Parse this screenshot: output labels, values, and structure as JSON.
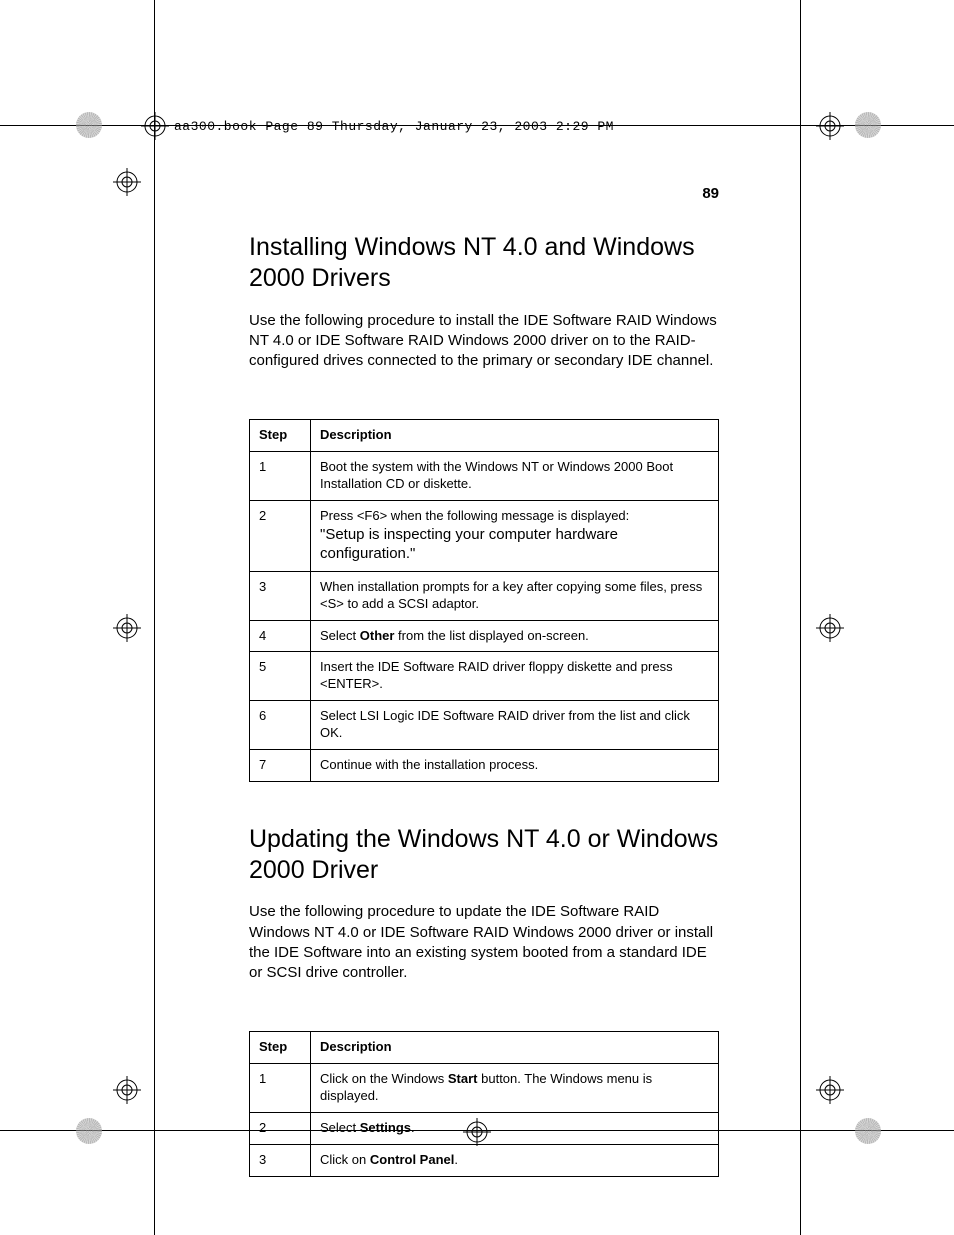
{
  "meta_header": "aa300.book  Page 89  Thursday, January 23, 2003  2:29 PM",
  "page_number": "89",
  "section1": {
    "heading": "Installing Windows NT 4.0 and Windows 2000 Drivers",
    "intro": "Use the following procedure to install the IDE Software RAID Windows NT 4.0 or IDE Software RAID Windows 2000 driver on to the RAID-configured drives connected to the primary or secondary IDE channel.",
    "table": {
      "headers": {
        "step": "Step",
        "desc": "Description"
      },
      "rows": [
        {
          "step": "1",
          "desc": "Boot the system with the Windows NT or Windows 2000 Boot Installation CD or diskette."
        },
        {
          "step": "2",
          "desc_pre": "Press <F6> when the following message is displayed:",
          "desc_quote": "\"Setup is inspecting your computer hardware configuration.\""
        },
        {
          "step": "3",
          "desc": "When installation prompts for a key after copying some files, press <S> to add a SCSI adaptor."
        },
        {
          "step": "4",
          "desc_pre": "Select ",
          "desc_bold": "Other",
          "desc_post": " from the list displayed on-screen."
        },
        {
          "step": "5",
          "desc": "Insert the IDE Software RAID driver floppy diskette and press <ENTER>."
        },
        {
          "step": "6",
          "desc": "Select LSI Logic IDE Software RAID driver from the list and click OK."
        },
        {
          "step": "7",
          "desc": "Continue with the installation process."
        }
      ]
    }
  },
  "section2": {
    "heading": "Updating the Windows NT 4.0 or Windows 2000 Driver",
    "intro": "Use the following procedure to update the IDE Software RAID Windows NT 4.0 or IDE Software RAID Windows 2000 driver or install the IDE Software into an existing system booted from a standard IDE or SCSI drive controller.",
    "table": {
      "headers": {
        "step": "Step",
        "desc": "Description"
      },
      "rows": [
        {
          "step": "1",
          "desc_pre": "Click on the Windows ",
          "desc_bold": "Start",
          "desc_post": " button. The Windows menu is displayed."
        },
        {
          "step": "2",
          "desc_pre": "Select ",
          "desc_bold": "Settings",
          "desc_post": "."
        },
        {
          "step": "3",
          "desc_pre": "Click on ",
          "desc_bold": "Control Panel",
          "desc_post": "."
        }
      ]
    }
  }
}
